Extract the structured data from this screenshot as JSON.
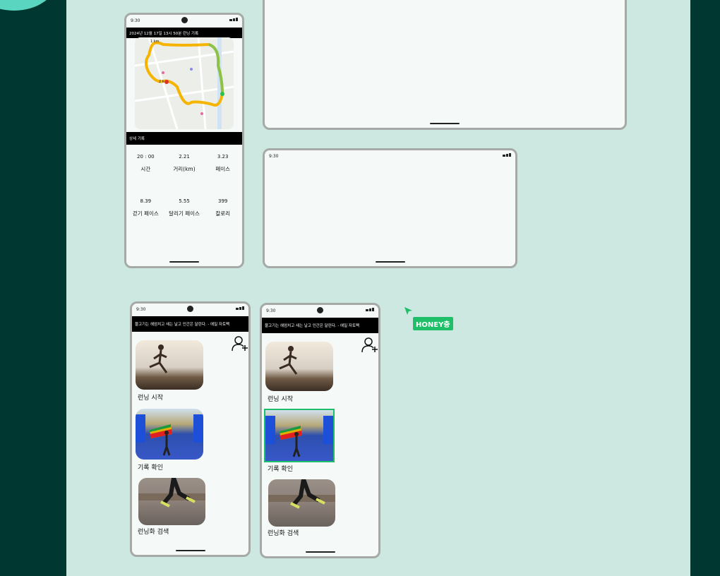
{
  "colors": {
    "outer_bg": "#003831",
    "canvas_bg": "#cde8e0",
    "phone_bg": "#f5faf8",
    "accent": "#1fbf6a"
  },
  "status": {
    "time": "9:30"
  },
  "record_screen": {
    "header": "2024년 12월 17일  13시 50분 런닝 기록",
    "map_labels": {
      "km1": "1 km",
      "km2": "2 k"
    },
    "detail_title": "상세 기록",
    "stats": [
      {
        "value": "20 : 00",
        "label": "시간"
      },
      {
        "value": "2.21",
        "label": "거리(km)"
      },
      {
        "value": "3.23",
        "label": "페이스"
      },
      {
        "value": "8.39",
        "label": "걷기 페이스"
      },
      {
        "value": "5.55",
        "label": "달리기 페이스"
      },
      {
        "value": "399",
        "label": "칼로리"
      }
    ]
  },
  "home_screen": {
    "quote": "물고기는 헤엄치고 새는 날고 인간은 달린다. - 에밀 자토펙",
    "menu": [
      {
        "label": "런닝 시작",
        "icon": "runner-sunset-photo"
      },
      {
        "label": "기록 확인",
        "icon": "marathon-finish-photo"
      },
      {
        "label": "런닝화 검색",
        "icon": "running-legs-photo"
      }
    ]
  },
  "cursor": {
    "tag": "HONEY충"
  }
}
